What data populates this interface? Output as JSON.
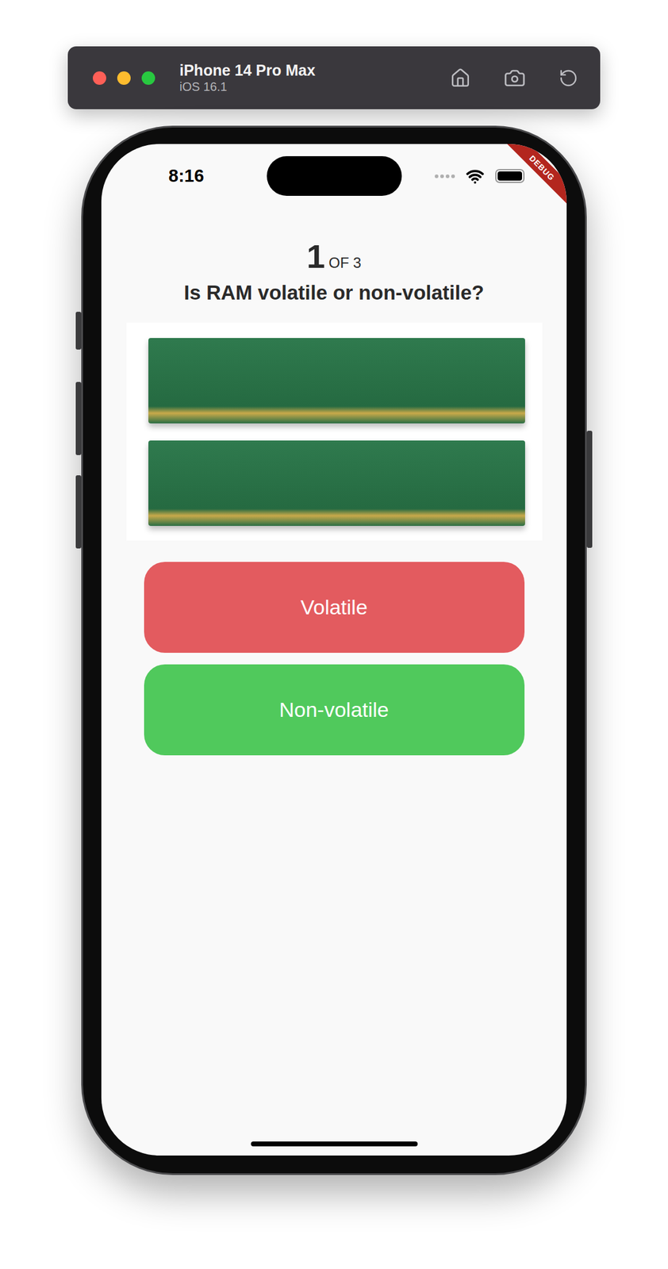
{
  "window": {
    "title": "iPhone 14 Pro Max",
    "subtitle": "iOS 16.1"
  },
  "status_bar": {
    "time": "8:16"
  },
  "debug_banner": "DEBUG",
  "quiz": {
    "current": "1",
    "total": "OF 3",
    "question": "Is RAM volatile or non-volatile?",
    "answers": [
      {
        "label": "Volatile",
        "color": "#e35b5f"
      },
      {
        "label": "Non-volatile",
        "color": "#50c95c"
      }
    ]
  }
}
